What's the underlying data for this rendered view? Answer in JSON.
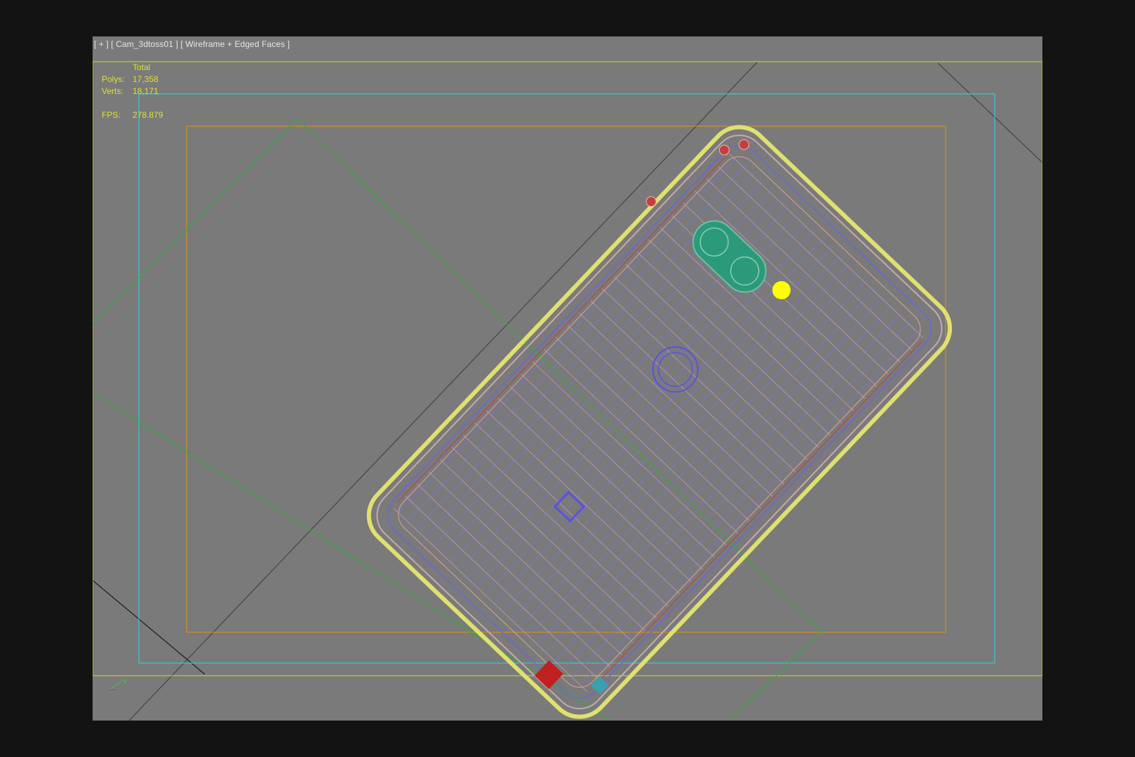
{
  "viewport": {
    "label_plus": "[ + ]",
    "label_camera": "[ Cam_3dtoss01 ]",
    "label_mode": "[ Wireframe + Edged Faces ]"
  },
  "stats": {
    "header": "Total",
    "polys_label": "Polys:",
    "polys_value": "17,358",
    "verts_label": "Verts:",
    "verts_value": "18,171",
    "fps_label": "FPS:",
    "fps_value": "278.879"
  },
  "axis": {
    "y_label": "y"
  },
  "colors": {
    "viewport_bg": "#7a7a7a",
    "frame_bg": "#131313",
    "safe_frame_yellow": "#d8d820",
    "safe_frame_cyan": "#3cc8d0",
    "safe_frame_orange": "#d09020",
    "camera_cone_green": "#30b030",
    "phone_outline": "#e0e070",
    "wire_blue": "#6a64e0",
    "wire_pink": "#e0a0a0",
    "camera_module_teal": "#2a9a7a",
    "light_yellow": "#ffff00"
  }
}
